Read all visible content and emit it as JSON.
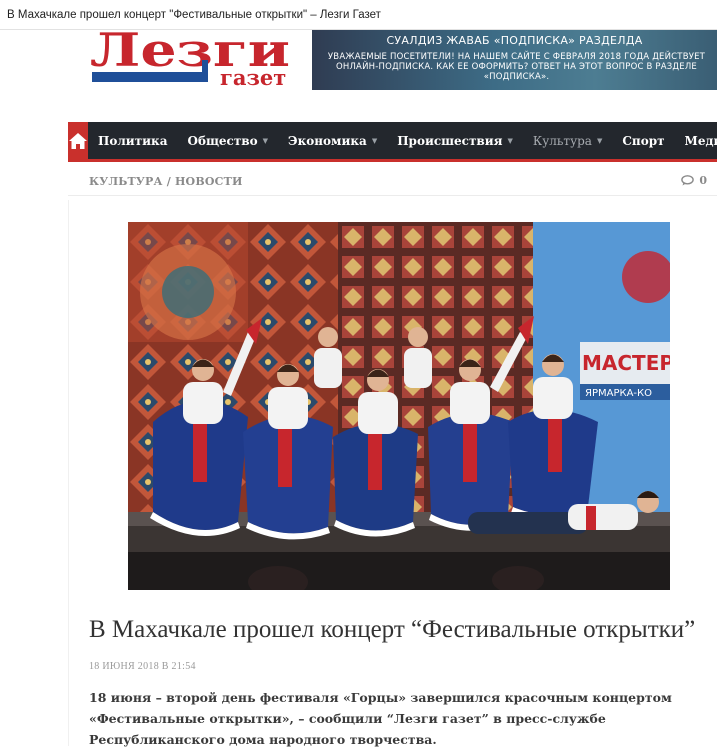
{
  "window": {
    "title": "В Махачкале прошел концерт \"Фестивальные открытки\" – Лезги Газет"
  },
  "logo": {
    "line1": "Лезги",
    "line2": "газет"
  },
  "banner": {
    "heading": "СУАЛДИЗ ЖАВАБ «ПОДПИСКА» РАЗДЕЛДА",
    "text": "УВАЖАЕМЫЕ ПОСЕТИТЕЛИ! НА НАШЕМ САЙТЕ С ФЕВРАЛЯ 2018 ГОДА ДЕЙСТВУЕТ ОНЛАЙН-ПОДПИСКА. КАК ЕЕ ОФОРМИТЬ? ОТВЕТ НА ЭТОТ ВОПРОС В РАЗДЕЛЕ «ПОДПИСКА»."
  },
  "nav": {
    "items": [
      {
        "label": "Политика",
        "has_dropdown": false
      },
      {
        "label": "Общество",
        "has_dropdown": true
      },
      {
        "label": "Экономика",
        "has_dropdown": true
      },
      {
        "label": "Происшествия",
        "has_dropdown": true
      },
      {
        "label": "Культура",
        "has_dropdown": true,
        "active": true
      },
      {
        "label": "Спорт",
        "has_dropdown": false
      },
      {
        "label": "Медиа",
        "has_dropdown": true
      }
    ],
    "home_icon": "home-icon",
    "caret": "▼"
  },
  "breadcrumb": {
    "text": "КУЛЬТУРА / НОВОСТИ"
  },
  "comments": {
    "count": "0",
    "icon": "comment-icon"
  },
  "article": {
    "title": "В Махачкале прошел концерт “Фестивальные открытки”",
    "date": "18 ИЮНЯ 2018 В 21:54",
    "lead": "18 июня – второй день фестиваля «Горцы» завершился красочным концертом «Фестивальные открытки», – сообщили “Лезги газет” в пресс-службе Республиканского дома народного творчества.",
    "photo_stage_text": "МАСТЕРОВ",
    "photo_stage_text2": "ЯРМАРКА-КО"
  },
  "colors": {
    "accent": "#c9302c",
    "nav_bg": "#23272d",
    "logo_red": "#c7262d",
    "logo_blue": "#1f4f99"
  }
}
